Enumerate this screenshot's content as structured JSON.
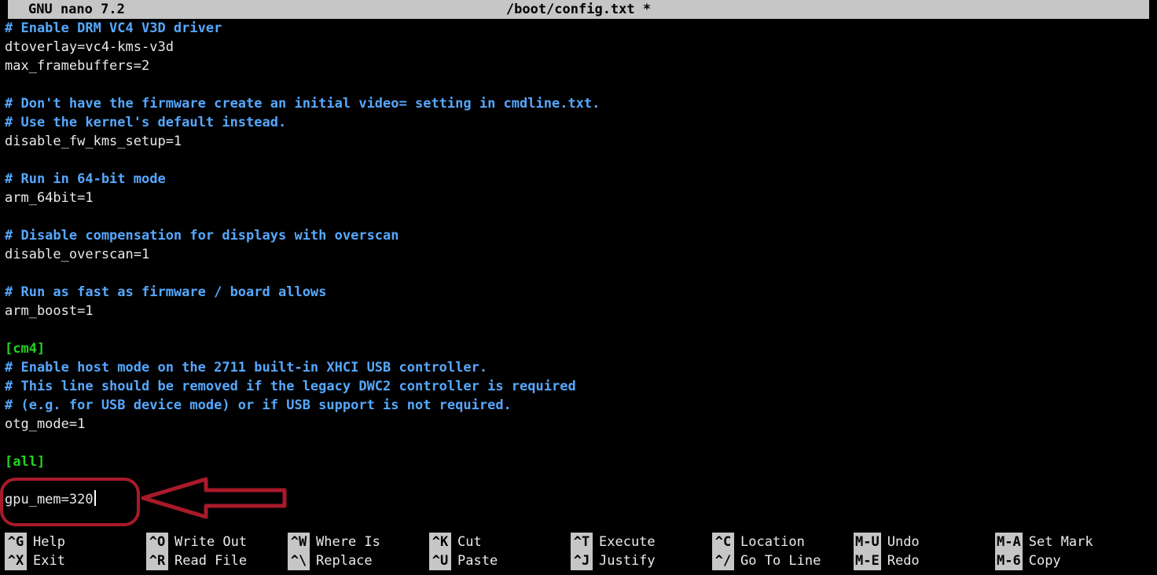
{
  "title": {
    "app": "GNU nano 7.2",
    "file": "/boot/config.txt *"
  },
  "lines": [
    {
      "cls": "cmt",
      "text": "# Enable DRM VC4 V3D driver"
    },
    {
      "cls": "plain",
      "text": "dtoverlay=vc4-kms-v3d"
    },
    {
      "cls": "plain",
      "text": "max_framebuffers=2"
    },
    {
      "cls": "plain",
      "text": ""
    },
    {
      "cls": "cmt",
      "text": "# Don't have the firmware create an initial video= setting in cmdline.txt."
    },
    {
      "cls": "cmt",
      "text": "# Use the kernel's default instead."
    },
    {
      "cls": "plain",
      "text": "disable_fw_kms_setup=1"
    },
    {
      "cls": "plain",
      "text": ""
    },
    {
      "cls": "cmt",
      "text": "# Run in 64-bit mode"
    },
    {
      "cls": "plain",
      "text": "arm_64bit=1"
    },
    {
      "cls": "plain",
      "text": ""
    },
    {
      "cls": "cmt",
      "text": "# Disable compensation for displays with overscan"
    },
    {
      "cls": "plain",
      "text": "disable_overscan=1"
    },
    {
      "cls": "plain",
      "text": ""
    },
    {
      "cls": "cmt",
      "text": "# Run as fast as firmware / board allows"
    },
    {
      "cls": "plain",
      "text": "arm_boost=1"
    },
    {
      "cls": "plain",
      "text": ""
    },
    {
      "cls": "sect",
      "text": "[cm4]"
    },
    {
      "cls": "cmt",
      "text": "# Enable host mode on the 2711 built-in XHCI USB controller."
    },
    {
      "cls": "cmt",
      "text": "# This line should be removed if the legacy DWC2 controller is required"
    },
    {
      "cls": "cmt",
      "text": "# (e.g. for USB device mode) or if USB support is not required."
    },
    {
      "cls": "plain",
      "text": "otg_mode=1"
    },
    {
      "cls": "plain",
      "text": ""
    },
    {
      "cls": "sect",
      "text": "[all]"
    },
    {
      "cls": "plain",
      "text": ""
    },
    {
      "cls": "plain",
      "text": "gpu_mem=320",
      "cursor": true
    }
  ],
  "shortcuts": {
    "row1": [
      {
        "key": "^G",
        "label": "Help"
      },
      {
        "key": "^O",
        "label": "Write Out"
      },
      {
        "key": "^W",
        "label": "Where Is"
      },
      {
        "key": "^K",
        "label": "Cut"
      },
      {
        "key": "^T",
        "label": "Execute"
      },
      {
        "key": "^C",
        "label": "Location"
      },
      {
        "key": "M-U",
        "label": "Undo"
      },
      {
        "key": "M-A",
        "label": "Set Mark"
      }
    ],
    "row2": [
      {
        "key": "^X",
        "label": "Exit"
      },
      {
        "key": "^R",
        "label": "Read File"
      },
      {
        "key": "^\\",
        "label": "Replace"
      },
      {
        "key": "^U",
        "label": "Paste"
      },
      {
        "key": "^J",
        "label": "Justify"
      },
      {
        "key": "^/",
        "label": "Go To Line"
      },
      {
        "key": "M-E",
        "label": "Redo"
      },
      {
        "key": "M-6",
        "label": "Copy"
      }
    ]
  }
}
